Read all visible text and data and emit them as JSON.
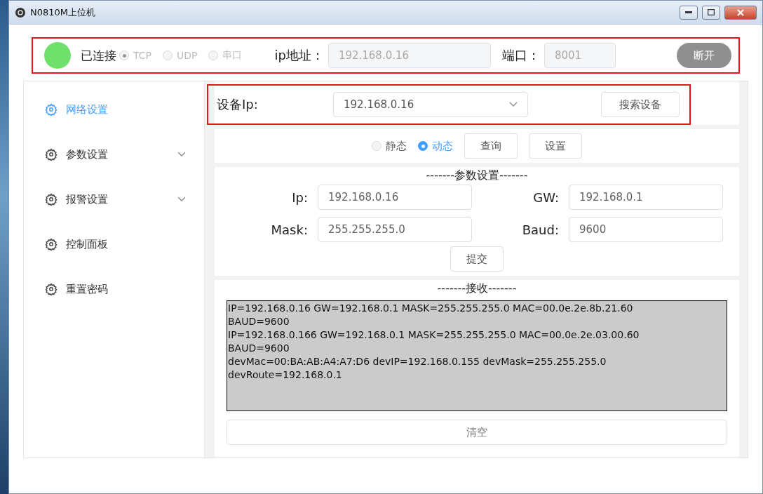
{
  "window": {
    "title": "N0810M上位机"
  },
  "connection": {
    "connected": true,
    "status": "已连接",
    "protocols": [
      {
        "label": "TCP",
        "selected": true
      },
      {
        "label": "UDP",
        "selected": false
      },
      {
        "label": "串口",
        "selected": false
      }
    ],
    "ip_label": "ip地址：",
    "ip_value": "192.168.0.16",
    "port_label": "端口：",
    "port_value": "8001",
    "button": "断开"
  },
  "sidebar": {
    "items": [
      {
        "label": "网络设置",
        "selected": true,
        "expandable": false
      },
      {
        "label": "参数设置",
        "selected": false,
        "expandable": true
      },
      {
        "label": "报警设置",
        "selected": false,
        "expandable": true
      },
      {
        "label": "控制面板",
        "selected": false,
        "expandable": false
      },
      {
        "label": "重置密码",
        "selected": false,
        "expandable": false
      }
    ]
  },
  "device": {
    "label": "设备Ip:",
    "value": "192.168.0.16",
    "button": "搜索设备"
  },
  "mode": {
    "options": [
      {
        "label": "静态",
        "selected": false
      },
      {
        "label": "动态",
        "selected": true
      }
    ],
    "buttons": [
      "查询",
      "设置"
    ]
  },
  "params": {
    "title": "-------参数设置-------",
    "fields": [
      {
        "label": "Ip:",
        "value": "192.168.0.16"
      },
      {
        "label": "GW:",
        "value": "192.168.0.1"
      },
      {
        "label": "Mask:",
        "value": "255.255.255.0"
      },
      {
        "label": "Baud:",
        "value": "9600"
      }
    ],
    "button": "提交"
  },
  "receive": {
    "title": "-------接收-------",
    "lines": [
      "IP=192.168.0.16 GW=192.168.0.1 MASK=255.255.255.0 MAC=00.0e.2e.8b.21.60",
      "BAUD=9600",
      "IP=192.168.0.166 GW=192.168.0.1 MASK=255.255.255.0 MAC=00.0e.2e.03.00.60",
      "BAUD=9600",
      "devMac=00:BA:AB:A4:A7:D6 devIP=192.168.0.155 devMask=255.255.255.0",
      "devRoute=192.168.0.1"
    ],
    "button": "清空"
  }
}
